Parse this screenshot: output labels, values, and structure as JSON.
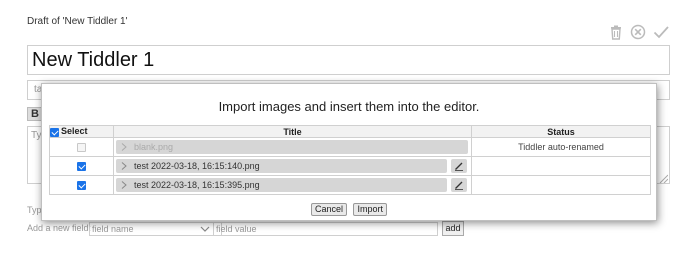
{
  "editor": {
    "draft_label": "Draft of 'New Tiddler 1'",
    "title_value": "New Tiddler 1",
    "tags_placeholder": "ta",
    "bold_label": "B",
    "text_placeholder": "Typ",
    "type_label": "Typ",
    "add_field_label": "Add a new field:",
    "field_name_placeholder": "field name",
    "field_value_placeholder": "field value",
    "add_button": "add",
    "toolbar_icons": [
      "trash-icon",
      "cancel-icon",
      "done-check-icon"
    ]
  },
  "import_modal": {
    "heading": "Import images and insert them into the editor.",
    "columns": {
      "select": "Select",
      "title": "Title",
      "status": "Status"
    },
    "header_checkbox_checked": true,
    "rows": [
      {
        "checked": false,
        "disabled": true,
        "title": "blank.png",
        "status": "Tiddler auto-renamed"
      },
      {
        "checked": true,
        "disabled": false,
        "title": "test 2022-03-18, 16:15:140.png",
        "status": ""
      },
      {
        "checked": true,
        "disabled": false,
        "title": "test 2022-03-18, 16:15:395.png",
        "status": ""
      }
    ],
    "cancel_button": "Cancel",
    "import_button": "Import"
  },
  "colors": {
    "checkbox_accent": "#1a73e8",
    "filename_bar": "#d6d6d6",
    "toolbar_icon": "#bbbbbb"
  }
}
